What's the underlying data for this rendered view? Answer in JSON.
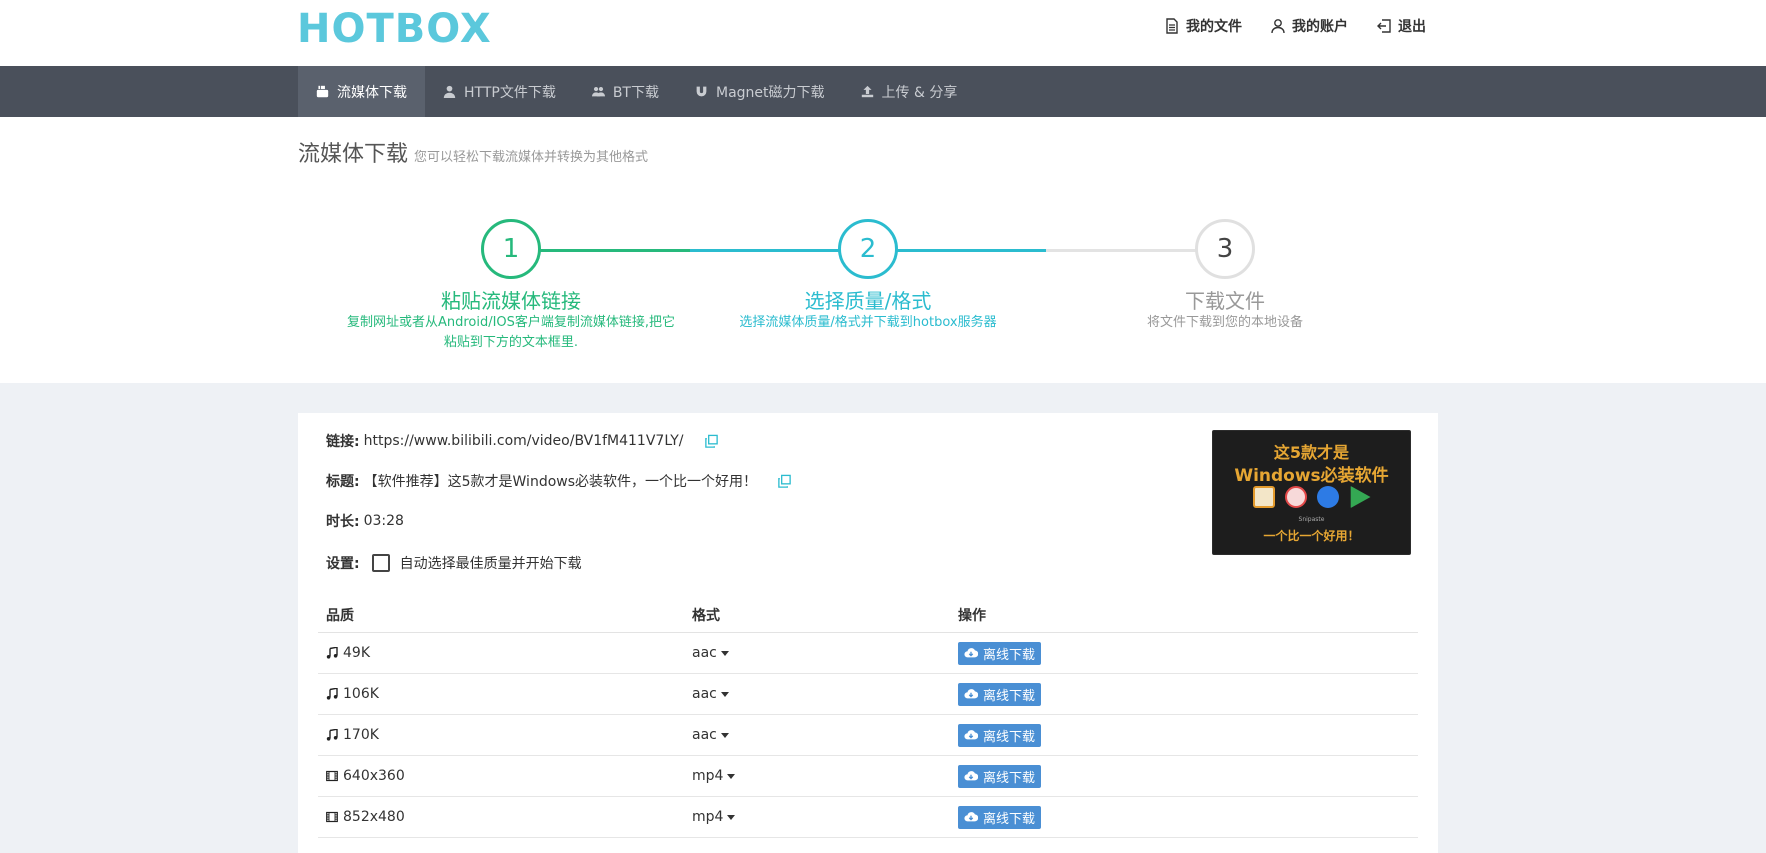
{
  "brand": {
    "logo": "HOTBOX",
    "logo_color": "#5bc8dc"
  },
  "top_links": [
    {
      "label": "我的文件",
      "icon": "file-icon"
    },
    {
      "label": "我的账户",
      "icon": "user-icon"
    },
    {
      "label": "退出",
      "icon": "logout-icon"
    }
  ],
  "nav": [
    {
      "label": "流媒体下载",
      "icon": "youtube-icon",
      "active": true
    },
    {
      "label": "HTTP文件下载",
      "icon": "user-icon",
      "active": false
    },
    {
      "label": "BT下载",
      "icon": "users-icon",
      "active": false
    },
    {
      "label": "Magnet磁力下载",
      "icon": "magnet-icon",
      "active": false
    },
    {
      "label": "上传 & 分享",
      "icon": "upload-icon",
      "active": false
    }
  ],
  "page": {
    "title": "流媒体下载",
    "subtitle": "您可以轻松下载流媒体并转换为其他格式"
  },
  "steps": [
    {
      "num": "1",
      "title": "粘贴流媒体链接",
      "desc_line1": "复制网址或者从Android/IOS客户端复制流媒体链接,把它",
      "desc_line2": "粘贴到下方的文本框里.",
      "state": "done",
      "color": "#26b97c"
    },
    {
      "num": "2",
      "title": "选择质量/格式",
      "desc_line1": "选择流媒体质量/格式并下载到hotbox服务器",
      "desc_line2": "",
      "state": "current",
      "color": "#2bbccf"
    },
    {
      "num": "3",
      "title": "下载文件",
      "desc_line1": "将文件下载到您的本地设备",
      "desc_line2": "",
      "state": "pending",
      "color": "#999999"
    }
  ],
  "info": {
    "link_label": "链接:",
    "link": "https://www.bilibili.com/video/BV1fM411V7LY/",
    "title_label": "标题:",
    "title": "【软件推荐】这5款才是Windows必装软件，一个比一个好用！",
    "duration_label": "时长:",
    "duration": "03:28",
    "settings_label": "设置:",
    "auto_select": "自动选择最佳质量并开始下载"
  },
  "promo": {
    "line1": "这5款才是",
    "line2": "Windows必装软件",
    "tiny": "Snipaste",
    "line3": "一个比一个好用！"
  },
  "table": {
    "headers": [
      "品质",
      "格式",
      "操作"
    ],
    "rows": [
      {
        "quality": "49K",
        "type": "audio",
        "format": "aac",
        "action": "离线下载"
      },
      {
        "quality": "106K",
        "type": "audio",
        "format": "aac",
        "action": "离线下载"
      },
      {
        "quality": "170K",
        "type": "audio",
        "format": "aac",
        "action": "离线下载"
      },
      {
        "quality": "640x360",
        "type": "video",
        "format": "mp4",
        "action": "离线下载"
      },
      {
        "quality": "852x480",
        "type": "video",
        "format": "mp4",
        "action": "离线下载"
      }
    ]
  }
}
